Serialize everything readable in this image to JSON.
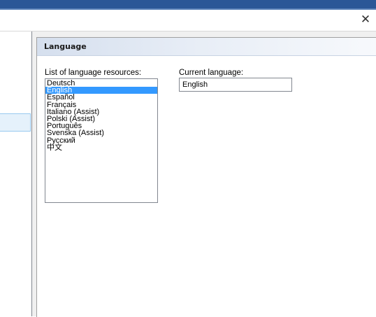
{
  "window": {
    "close_glyph": "✕"
  },
  "panel": {
    "title": "Language",
    "list_label": "List of language resources:",
    "current_label": "Current language:",
    "current_value": "English",
    "languages": [
      "Deutsch",
      "English",
      "Español",
      "Français",
      "Italiano (Assist)",
      "Polski (Assist)",
      "Português",
      "Svenska (Assist)",
      "Русский",
      "中文"
    ],
    "selected_language": "English"
  },
  "colors": {
    "titlebar": "#2b5797",
    "selection": "#3399ff",
    "left_selection": "#e5f1fb"
  },
  "icons": {
    "close": "close-icon"
  }
}
